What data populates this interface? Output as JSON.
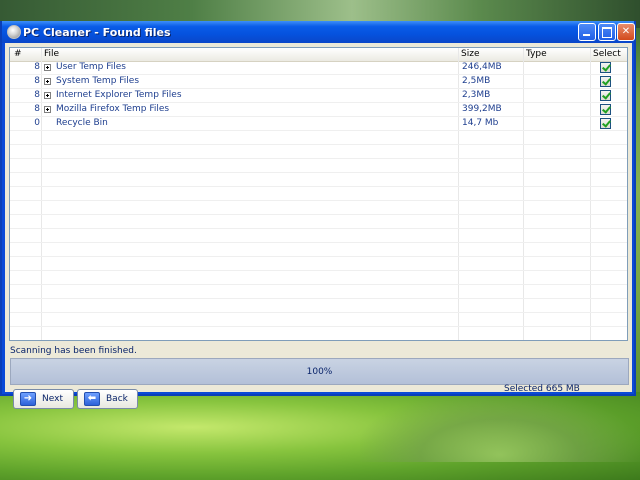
{
  "window": {
    "title": "PC Cleaner - Found files",
    "controls": {
      "minimize": "minimize-icon",
      "maximize": "maximize-icon",
      "close": "close-icon"
    }
  },
  "list": {
    "columns": {
      "num": "#",
      "file": "File",
      "size": "Size",
      "type": "Type",
      "select": "Select"
    },
    "rows": [
      {
        "num": "8",
        "expandable": true,
        "file": "User Temp Files",
        "size": "246,4MB",
        "type": "",
        "selected": true
      },
      {
        "num": "8",
        "expandable": true,
        "file": "System Temp Files",
        "size": "2,5MB",
        "type": "",
        "selected": true
      },
      {
        "num": "8",
        "expandable": true,
        "file": "Internet Explorer Temp Files",
        "size": "2,3MB",
        "type": "",
        "selected": true
      },
      {
        "num": "8",
        "expandable": true,
        "file": "Mozilla Firefox Temp Files",
        "size": "399,2MB",
        "type": "",
        "selected": true
      },
      {
        "num": "0",
        "expandable": false,
        "file": "Recycle Bin",
        "size": "14,7 Mb",
        "type": "",
        "selected": true
      }
    ]
  },
  "status": {
    "message": "Scanning has been finished."
  },
  "progress": {
    "label": "100%",
    "value": 1.0
  },
  "buttons": {
    "next": "Next",
    "back": "Back"
  },
  "selection": {
    "summary": "Selected 665 MB"
  },
  "colors": {
    "titlebar": "#0a5ce8",
    "client": "#ece9d8",
    "text": "#1f3f8f",
    "progress": "#b7c4da"
  }
}
